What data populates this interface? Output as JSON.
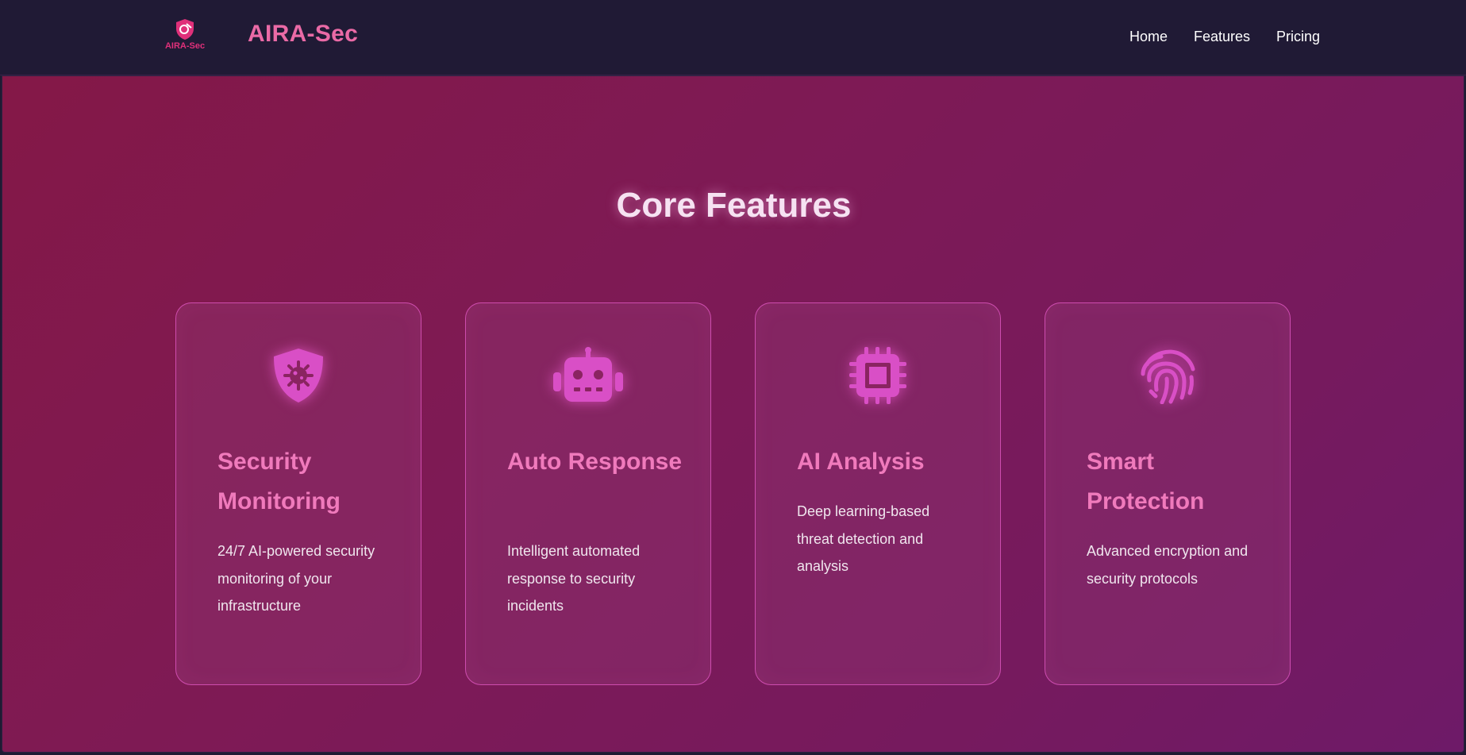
{
  "header": {
    "logo_text": "AIRA-Sec",
    "brand": "AIRA-Sec",
    "nav": [
      {
        "label": "Home"
      },
      {
        "label": "Features"
      },
      {
        "label": "Pricing"
      }
    ]
  },
  "main": {
    "title": "Core Features",
    "cards": [
      {
        "icon": "shield-virus-icon",
        "title": "Security Monitoring",
        "description": "24/7 AI-powered security monitoring of your infrastructure"
      },
      {
        "icon": "robot-icon",
        "title": "Auto Response",
        "description": "Intelligent automated response to security incidents"
      },
      {
        "icon": "microchip-icon",
        "title": "AI Analysis",
        "description": "Deep learning-based threat detection and analysis"
      },
      {
        "icon": "fingerprint-icon",
        "title": "Smart Protection",
        "description": "Advanced encryption and security protocols"
      }
    ]
  },
  "colors": {
    "nav_background": "#201a35",
    "accent_pink": "#ea6aa6",
    "icon_magenta": "#d94fc6",
    "card_border": "#e65ac8"
  }
}
